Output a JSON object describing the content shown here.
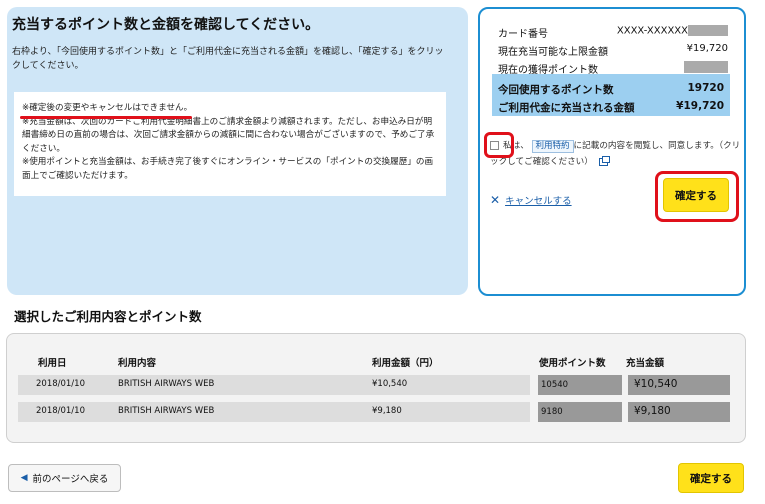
{
  "main_panel": {
    "title": "充当するポイント数と金額を確認してください。",
    "description": "右枠より、「今回使用するポイント数」と「ご利用代金に充当される金額」を確認し、「確定する」をクリックしてください。",
    "notice_lines": [
      "※確定後の変更やキャンセルはできません。",
      "※充当金額は、次回のカードご利用代金明細書上のご請求金額より減額されます。ただし、お申込み日が明細書締め日の直前の場合は、次回ご請求金額からの減額に間に合わない場合がございますので、予めご了承ください。",
      "※使用ポイントと充当金額は、お手続き完了後すぐにオンライン・サービスの「ポイントの交換履歴」の画面上でご確認いただけます。"
    ]
  },
  "summary": {
    "card_number_label": "カード番号",
    "card_number_value": "XXXX-XXXXXX",
    "limit_label": "現在充当可能な上限金額",
    "limit_value": "¥19,720",
    "points_label": "現在の獲得ポイント数",
    "use_points_label": "今回使用するポイント数",
    "use_points_value": "19720",
    "applied_amount_label": "ご利用代金に充当される金額",
    "applied_amount_value": "¥19,720",
    "agree_prefix": "私は、",
    "terms_link": "利用特約",
    "agree_suffix": "に記載の内容を閲覧し、同意します。（クリックしてご確認ください）",
    "cancel_label": "キャンセルする",
    "confirm_label": "確定する"
  },
  "usage": {
    "title": "選択したご利用内容とポイント数",
    "headers": [
      "利用日",
      "利用内容",
      "利用金額（円）",
      "使用ポイント数",
      "充当金額"
    ],
    "rows": [
      {
        "date": "2018/01/10",
        "merchant": "BRITISH AIRWAYS WEB",
        "amount": "¥10,540",
        "points": "10540",
        "applied": "¥10,540"
      },
      {
        "date": "2018/01/10",
        "merchant": "BRITISH AIRWAYS WEB",
        "amount": "¥9,180",
        "points": "9180",
        "applied": "¥9,180"
      }
    ]
  },
  "footer": {
    "back_label": "前のページへ戻る",
    "confirm_label": "確定する"
  },
  "colors": {
    "panel_blue": "#cfe6f7",
    "highlight_blue": "#9ccff0",
    "border_blue": "#1c8ed2",
    "button_yellow": "#ffe11a",
    "annotation_red": "#e0101a"
  }
}
